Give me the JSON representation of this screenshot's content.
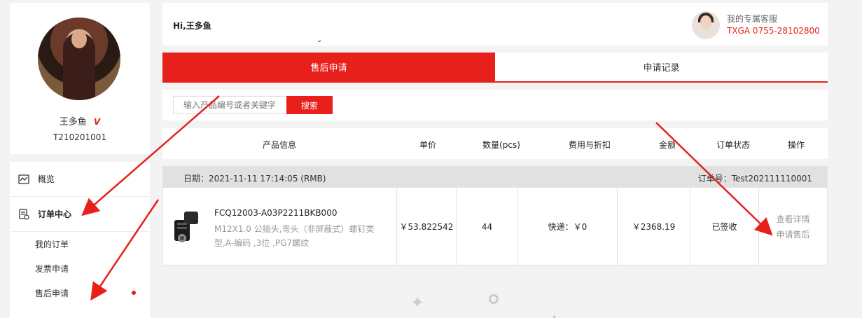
{
  "profile": {
    "username": "王多鱼",
    "vip_badge": "V",
    "user_id": "T210201001"
  },
  "menu": {
    "overview": "概览",
    "order_center": "订单中心",
    "sub_items": [
      {
        "label": "我的订单"
      },
      {
        "label": "发票申请"
      },
      {
        "label": "售后申请"
      }
    ]
  },
  "topbar": {
    "greeting": "Hi,王多鱼",
    "caret": "⌄",
    "service_title": "我的专属客服",
    "service_contact": "TXGA   0755-28102800"
  },
  "tabs": [
    {
      "label": "售后申请",
      "active": true
    },
    {
      "label": "申请记录",
      "active": false
    }
  ],
  "search": {
    "placeholder": "输入产品编号或者关键字",
    "button": "搜索"
  },
  "table_headers": {
    "product": "产品信息",
    "unit_price": "单价",
    "quantity": "数量(pcs)",
    "fee": "费用与折扣",
    "amount": "金额",
    "status": "订单状态",
    "action": "操作"
  },
  "order": {
    "date": "日期：2021-11-11 17:14:05 (RMB)",
    "order_no": "订单号：Test202111110001",
    "product_code": "FCQ12003-A03P2211BKB000",
    "product_desc": "M12X1.0 公插头,弯头（非屏蔽式）螺钉类型,A-编码 ,3位 ,PG7螺纹",
    "unit_price": "￥53.822542",
    "quantity": "44",
    "fee": "快递：￥0",
    "amount": "￥2368.19",
    "status": "已签收",
    "action_view": "查看详情",
    "action_aftersale": "申请售后"
  },
  "colors": {
    "accent": "#e8201b",
    "background": "#f3f3f3"
  }
}
